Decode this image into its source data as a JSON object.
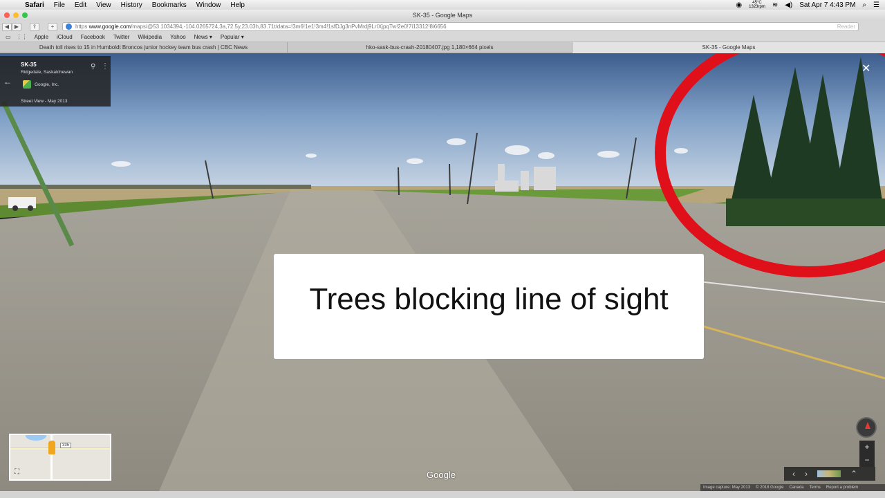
{
  "menubar": {
    "app": "Safari",
    "items": [
      "File",
      "Edit",
      "View",
      "History",
      "Bookmarks",
      "Window",
      "Help"
    ],
    "temp": "45°C",
    "rpm": "1323rpm",
    "datetime": "Sat Apr 7  4:43 PM"
  },
  "window": {
    "title": "SK-35 - Google Maps"
  },
  "address": {
    "prefix": "https",
    "domain": "www.google.com",
    "path": "/maps/@53.1034394,-104.0265724,3a,72.5y,23.03h,83.71t/data=!3m6!1e1!3m4!1sfDJg3nPvMrdj9LrIXjpqTw!2e0!7i13312!8i6656",
    "reader": "Reader"
  },
  "bookmarks": [
    "Apple",
    "iCloud",
    "Facebook",
    "Twitter",
    "Wikipedia",
    "Yahoo",
    "News ▾",
    "Popular ▾"
  ],
  "tabs": [
    {
      "label": "Death toll rises to 15 in Humboldt Broncos junior hockey team bus crash | CBC News"
    },
    {
      "label": "hko-sask-bus-crash-20180407.jpg 1,180×664 pixels"
    },
    {
      "label": "SK-35 - Google Maps"
    }
  ],
  "info_card": {
    "title": "SK-35",
    "subtitle": "Ridgedale, Saskatchewan",
    "owner": "Google, Inc.",
    "date": "Street View - May 2013"
  },
  "caption": "Trees blocking line of sight",
  "minimap": {
    "shield": "335"
  },
  "google_logo": "Google",
  "footer": {
    "capture": "Image capture: May 2013",
    "copyright": "© 2018 Google",
    "country": "Canada",
    "terms": "Terms",
    "report": "Report a problem"
  },
  "colors": {
    "highlight_circle": "#e0101a",
    "sky_top": "#3e5f8f",
    "grass": "#6f9a3a"
  }
}
